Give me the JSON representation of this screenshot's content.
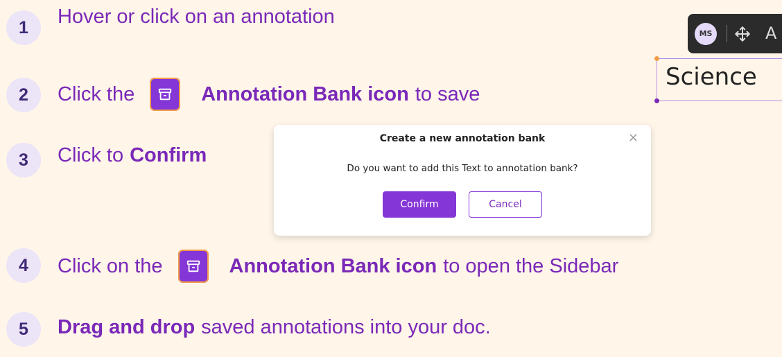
{
  "steps": [
    {
      "number": "1",
      "text": "Hover or click on an annotation"
    },
    {
      "number": "2",
      "pre": "Click the",
      "bold": "Annotation Bank icon",
      "post": "to save"
    },
    {
      "number": "3",
      "pre": "Click to",
      "bold": "Confirm"
    },
    {
      "number": "4",
      "pre": "Click on the",
      "bold": "Annotation Bank icon",
      "post": "to open the Sidebar"
    },
    {
      "number": "5",
      "bold": "Drag and drop",
      "post": "saved annotations into your doc."
    }
  ],
  "dialog": {
    "title": "Create a new annotation bank",
    "close": "×",
    "message": "Do you want to add this Text to annotation bank?",
    "confirm_label": "Confirm",
    "cancel_label": "Cancel"
  },
  "toolbar": {
    "avatar_initials": "MS",
    "partial_letter": "A"
  },
  "annotation": {
    "text": "Science"
  },
  "icons": {
    "bank": "archive-box-icon",
    "move": "move-arrows-icon"
  },
  "colors": {
    "background": "#fff6e9",
    "accent": "#8536d6",
    "text": "#7a28b8",
    "badge": "#ece4f7",
    "highlight": "#f29c4a"
  }
}
